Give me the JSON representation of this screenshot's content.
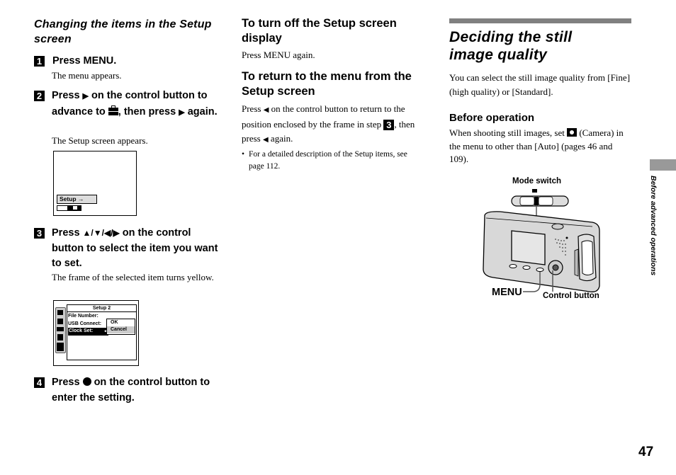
{
  "left": {
    "section_title": "Changing the items in the Setup screen",
    "steps": [
      {
        "num": "1",
        "text": "Press MENU.",
        "desc": "The menu appears."
      },
      {
        "num": "2",
        "text_a": "Press",
        "text_b": "on the control button to advance to",
        "text_c": ", then press",
        "text_d": "again.",
        "desc": "The Setup screen appears."
      },
      {
        "num": "3",
        "text_a": "Press",
        "arrows": "▲/▼/◀/▶",
        "text_b": "on the control button to select the item you want to set.",
        "desc": "The frame of the selected item turns yellow."
      },
      {
        "num": "4",
        "text_a": "Press",
        "text_b": "on the control button to enter the setting."
      }
    ],
    "screen1": {
      "setup_label": "Setup",
      "arrow": "→"
    },
    "screen2": {
      "title": "Setup 2",
      "items": [
        "File Number:",
        "USB Connect:",
        "Clock Set:"
      ],
      "options": [
        "OK",
        "Cancel"
      ]
    }
  },
  "middle": {
    "h1": "To turn off the Setup screen display",
    "p1": "Press MENU again.",
    "h2": "To return to the menu from the Setup screen",
    "p2_a": "Press",
    "p2_b": "on the control button to return to the position enclosed by the frame in step",
    "p2_step": "3",
    "p2_c": ", then press",
    "p2_d": "again.",
    "note": "For a detailed description of the Setup items, see page 112."
  },
  "right": {
    "title": "Deciding the still image quality",
    "intro": "You can select the still image quality from [Fine] (high quality) or [Standard].",
    "subhead": "Before operation",
    "before_a": "When shooting still images, set",
    "before_b": "(Camera) in the menu to other than [Auto] (pages 46 and 109).",
    "figure": {
      "mode_switch_label": "Mode switch",
      "menu_label": "MENU",
      "control_button_label": "Control button"
    }
  },
  "side_tab": {
    "label": "Before advanced operations"
  },
  "page_number": "47"
}
